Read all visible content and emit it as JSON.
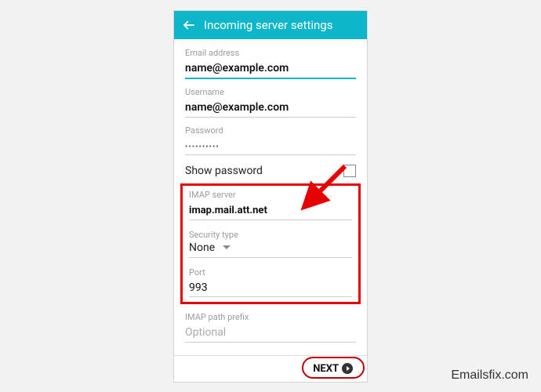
{
  "header": {
    "title": "Incoming server settings"
  },
  "fields": {
    "email": {
      "label": "Email address",
      "value": "name@example.com"
    },
    "username": {
      "label": "Username",
      "value": "name@example.com"
    },
    "password": {
      "label": "Password",
      "value": "••••••••••"
    },
    "show_password_label": "Show password",
    "imap_server": {
      "label": "IMAP server",
      "value": "imap.mail.att.net"
    },
    "security_type": {
      "label": "Security type",
      "value": "None"
    },
    "port": {
      "label": "Port",
      "value": "993"
    },
    "imap_prefix": {
      "label": "IMAP path prefix",
      "placeholder": "Optional",
      "value": ""
    }
  },
  "footer": {
    "next_label": "NEXT"
  },
  "watermark": "Emailsfix.com"
}
